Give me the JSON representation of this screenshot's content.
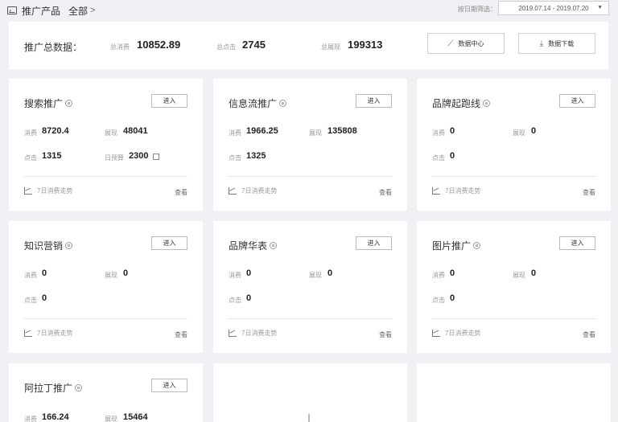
{
  "header": {
    "title": "推广产品",
    "crumb": "全部",
    "crumb_arrow": ">",
    "date_label": "按日期筛选：",
    "date_range": "2019.07.14 - 2019.07.20",
    "date_caret": "▼"
  },
  "summary": {
    "title": "推广总数据：",
    "spend_label": "总消费",
    "spend_value": "10852.89",
    "clicks_label": "总点击",
    "clicks_value": "2745",
    "impressions_label": "总展现",
    "impressions_value": "199313",
    "data_center_label": "数据中心",
    "download_label": "数据下载"
  },
  "cards": [
    {
      "title": "搜索推广",
      "enter": "进入",
      "spend_label": "消费",
      "spend": "8720.4",
      "imp_label": "展现",
      "imp": "48041",
      "click_label": "点击",
      "clicks": "1315",
      "budget_label": "日预算",
      "budget": "2300",
      "trend": "7日消费走势",
      "view": "查看"
    },
    {
      "title": "信息流推广",
      "enter": "进入",
      "spend_label": "消费",
      "spend": "1966.25",
      "imp_label": "展现",
      "imp": "135808",
      "click_label": "点击",
      "clicks": "1325",
      "trend": "7日消费走势",
      "view": "查看"
    },
    {
      "title": "品牌起跑线",
      "enter": "进入",
      "spend_label": "消费",
      "spend": "0",
      "imp_label": "展现",
      "imp": "0",
      "click_label": "点击",
      "clicks": "0",
      "trend": "7日消费走势",
      "view": "查看"
    },
    {
      "title": "知识营销",
      "enter": "进入",
      "spend_label": "消费",
      "spend": "0",
      "imp_label": "展现",
      "imp": "0",
      "click_label": "点击",
      "clicks": "0",
      "trend": "7日消费走势",
      "view": "查看"
    },
    {
      "title": "品牌华表",
      "enter": "进入",
      "spend_label": "消费",
      "spend": "0",
      "imp_label": "展现",
      "imp": "0",
      "click_label": "点击",
      "clicks": "0",
      "trend": "7日消费走势",
      "view": "查看"
    },
    {
      "title": "图片推广",
      "enter": "进入",
      "spend_label": "消费",
      "spend": "0",
      "imp_label": "展现",
      "imp": "0",
      "click_label": "点击",
      "clicks": "0",
      "trend": "7日消费走势",
      "view": "查看"
    },
    {
      "title": "阿拉丁推广",
      "enter": "进入",
      "spend_label": "消费",
      "spend": "166.24",
      "imp_label": "展现",
      "imp": "15464"
    }
  ]
}
